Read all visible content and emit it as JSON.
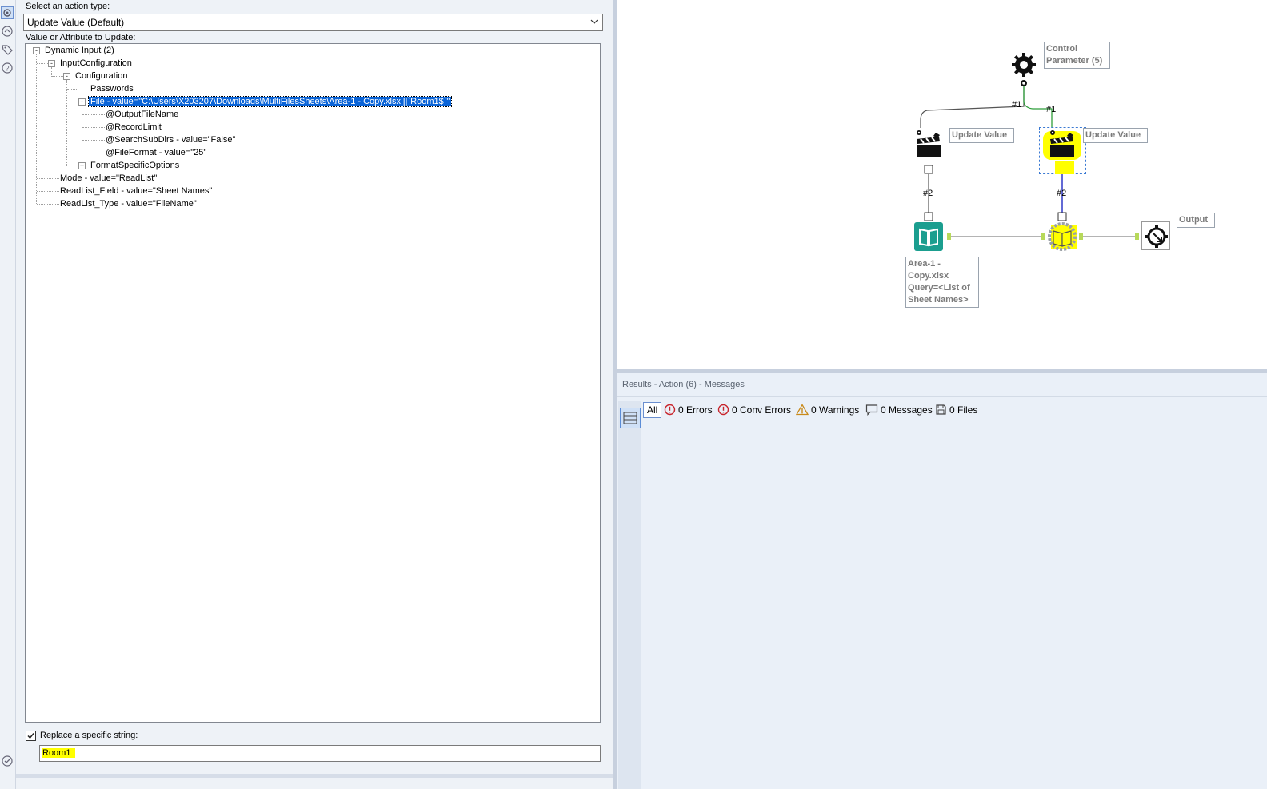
{
  "config": {
    "action_label": "Select an action type:",
    "action_value": "Update Value (Default)",
    "value_label": "Value or Attribute to Update:",
    "tree": {
      "n1": "Dynamic Input (2)",
      "n2": "InputConfiguration",
      "n3": "Configuration",
      "n4": "Passwords",
      "n5": "File - value=\"C:\\Users\\X203207\\Downloads\\MultiFilesSheets\\Area-1 - Copy.xlsx|||`Room1$`\"",
      "n6": "@OutputFileName",
      "n7": "@RecordLimit",
      "n8": "@SearchSubDirs - value=\"False\"",
      "n9": "@FileFormat - value=\"25\"",
      "n10": "FormatSpecificOptions",
      "n11": "Mode - value=\"ReadList\"",
      "n12": "ReadList_Field - value=\"Sheet Names\"",
      "n13": "ReadList_Type - value=\"FileName\""
    },
    "replace_checked": true,
    "replace_label": "Replace a specific string:",
    "replace_value": "Room1"
  },
  "canvas": {
    "control_param_label": "Control\nParameter (5)",
    "update_value_1": "Update Value",
    "update_value_2": "Update Value",
    "input_label": "Area-1 -\nCopy.xlsx\nQuery=<List of\nSheet Names>",
    "output_label": "Output",
    "conn_1a": "#1",
    "conn_1b": "#1",
    "conn_2a": "#2",
    "conn_2b": "#2"
  },
  "results": {
    "title": "Results - Action (6) - Messages",
    "all": "All",
    "errors": "0 Errors",
    "conv_errors": "0 Conv Errors",
    "warnings": "0 Warnings",
    "messages": "0 Messages",
    "files": "0 Files"
  },
  "colors": {
    "selection": "#0a64d8",
    "highlight": "#ffff00",
    "input_tool": "#1b9e8f",
    "connector_green": "#2e9e3a",
    "connector_blue": "#2f39c7"
  }
}
